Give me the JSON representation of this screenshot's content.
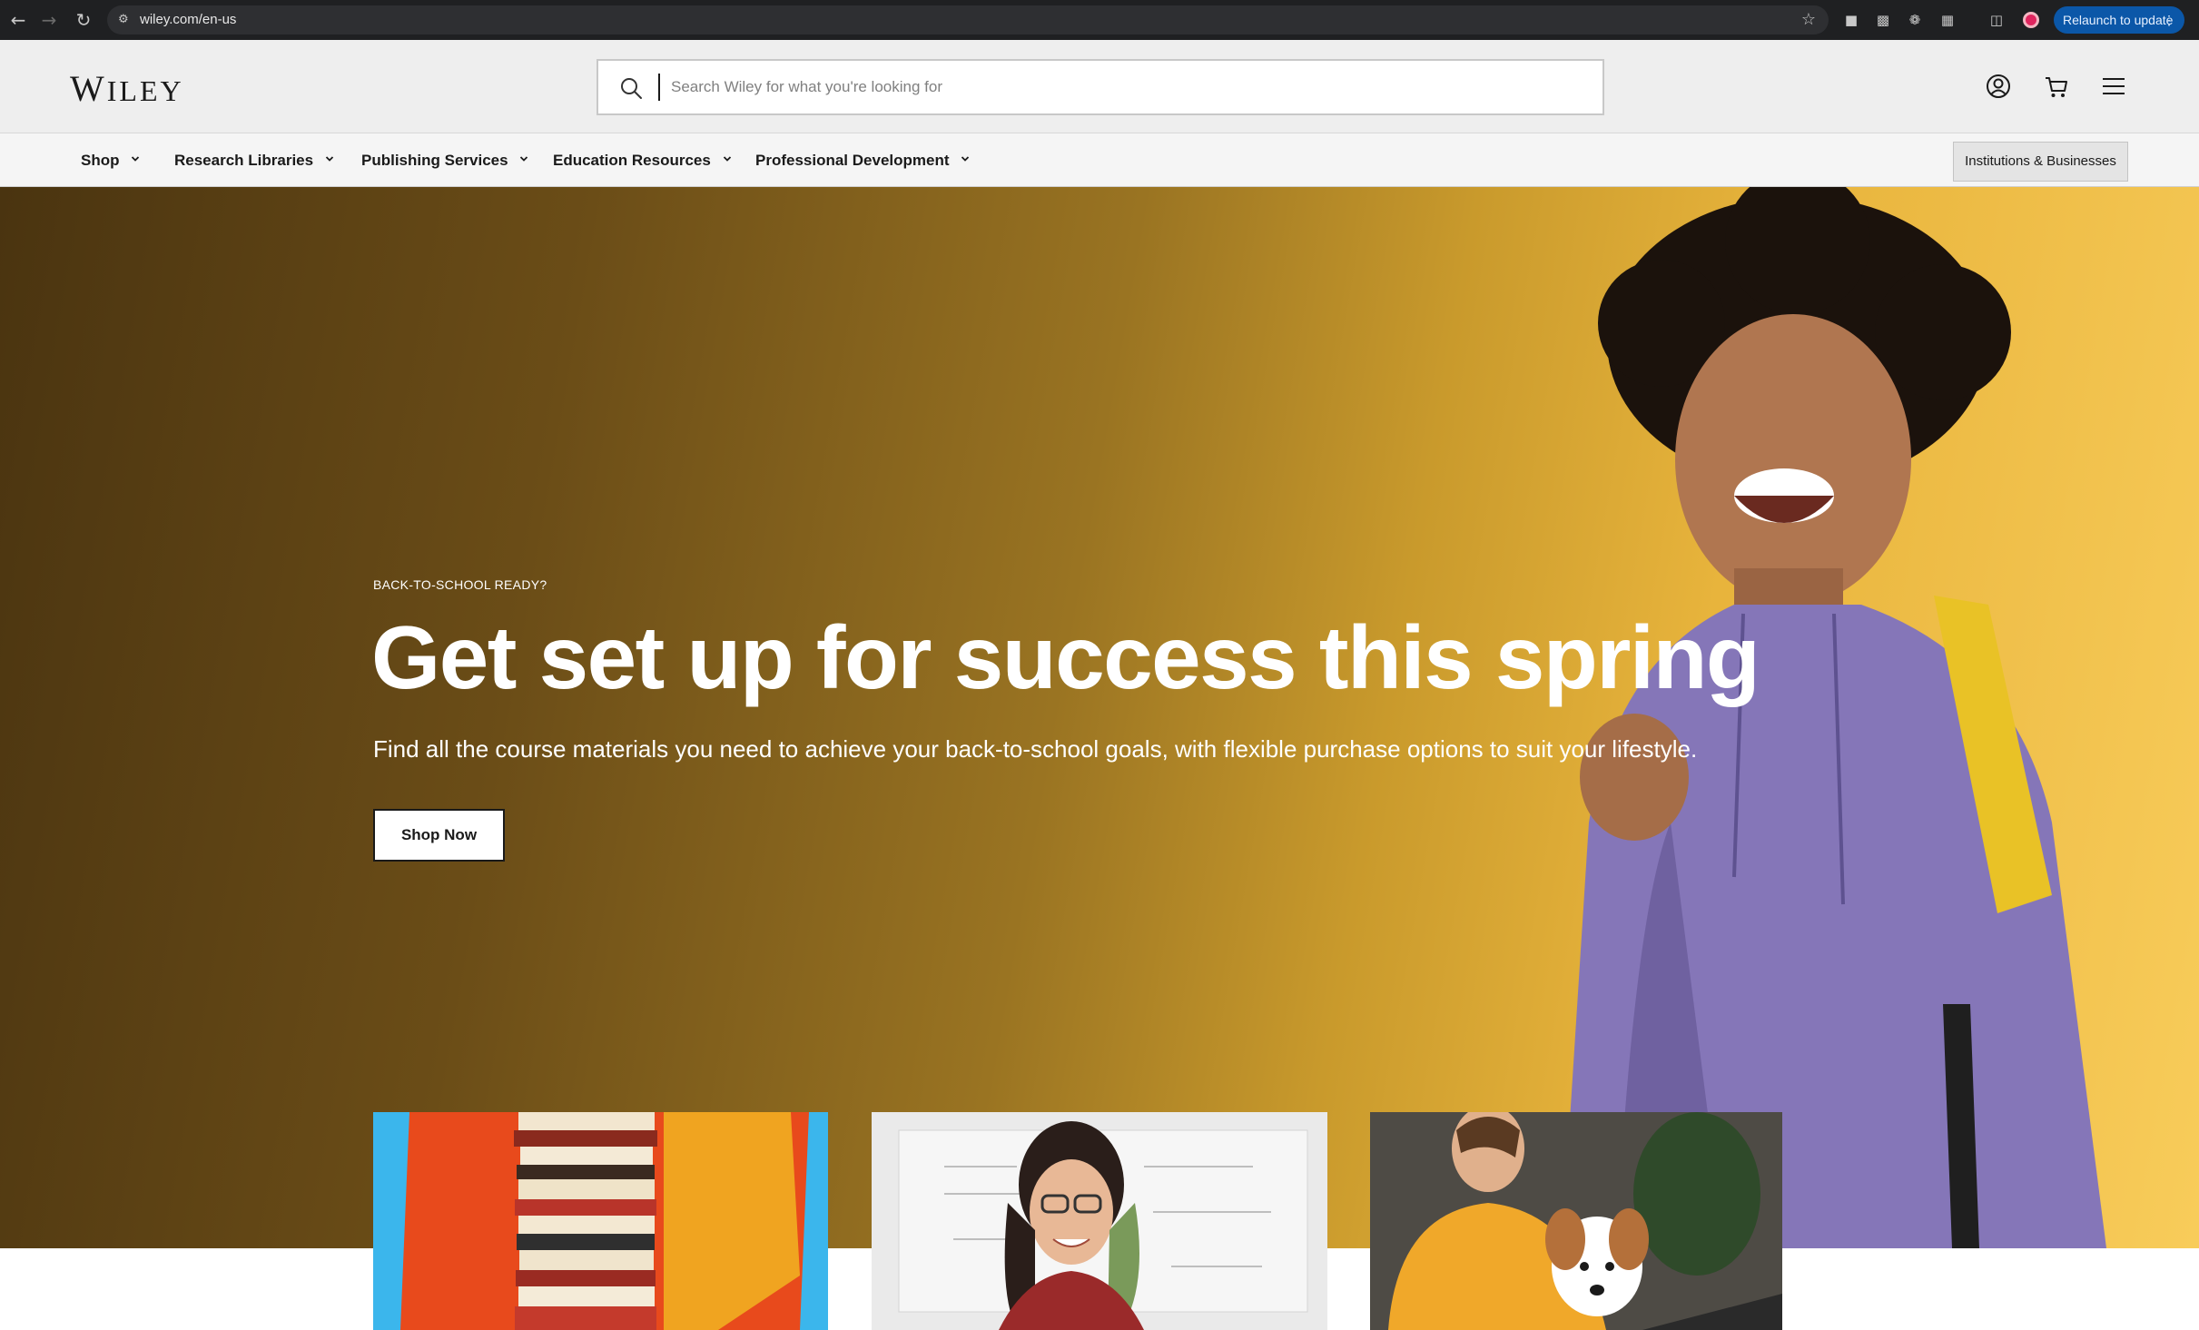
{
  "browser": {
    "url": "wiley.com/en-us",
    "relaunch_label": "Relaunch to update"
  },
  "header": {
    "logo_text": "WILEY",
    "search_placeholder": "Search Wiley for what you're looking for"
  },
  "nav": {
    "items": [
      {
        "label": "Shop"
      },
      {
        "label": "Research Libraries"
      },
      {
        "label": "Publishing Services"
      },
      {
        "label": "Education Resources"
      },
      {
        "label": "Professional Development"
      }
    ],
    "institutions_label": "Institutions & Businesses"
  },
  "hero": {
    "eyebrow": "BACK-TO-SCHOOL READY?",
    "headline": "Get set up for success this spring",
    "subhead": "Find all the course materials you need to achieve your back-to-school goals, with flexible purchase options to suit your lifestyle.",
    "cta_label": "Shop Now"
  },
  "colors": {
    "hero_dark": "#4a3410",
    "hero_light": "#f8cc5a",
    "relaunch_blue": "#0b57a8"
  },
  "icons": {
    "back": "arrow-left-icon",
    "forward": "arrow-right-icon",
    "reload": "reload-icon",
    "bookmark": "star-icon",
    "search": "search-icon",
    "account": "user-icon",
    "cart": "cart-icon",
    "menu": "hamburger-icon"
  }
}
